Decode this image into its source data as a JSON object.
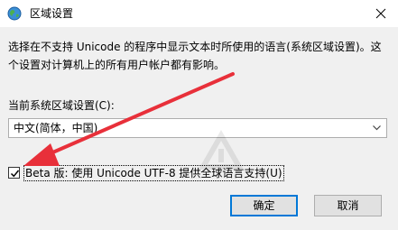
{
  "window": {
    "title": "区域设置",
    "icon": "globe-icon",
    "close_icon": "close-icon"
  },
  "main": {
    "description": "选择在不支持 Unicode 的程序中显示文本时所使用的语言(系统区域设置)。这个设置对计算机上的所有用户帐户都有影响。",
    "locale_label": "当前系统区域设置(C):",
    "locale_value": "中文(简体，中国)",
    "beta_checkbox_label": "Beta 版: 使用 Unicode UTF-8 提供全球语言支持(U)",
    "beta_checked": true
  },
  "buttons": {
    "ok": "确定",
    "cancel": "取消"
  },
  "annotation": {
    "arrow_color": "#e8303a"
  }
}
